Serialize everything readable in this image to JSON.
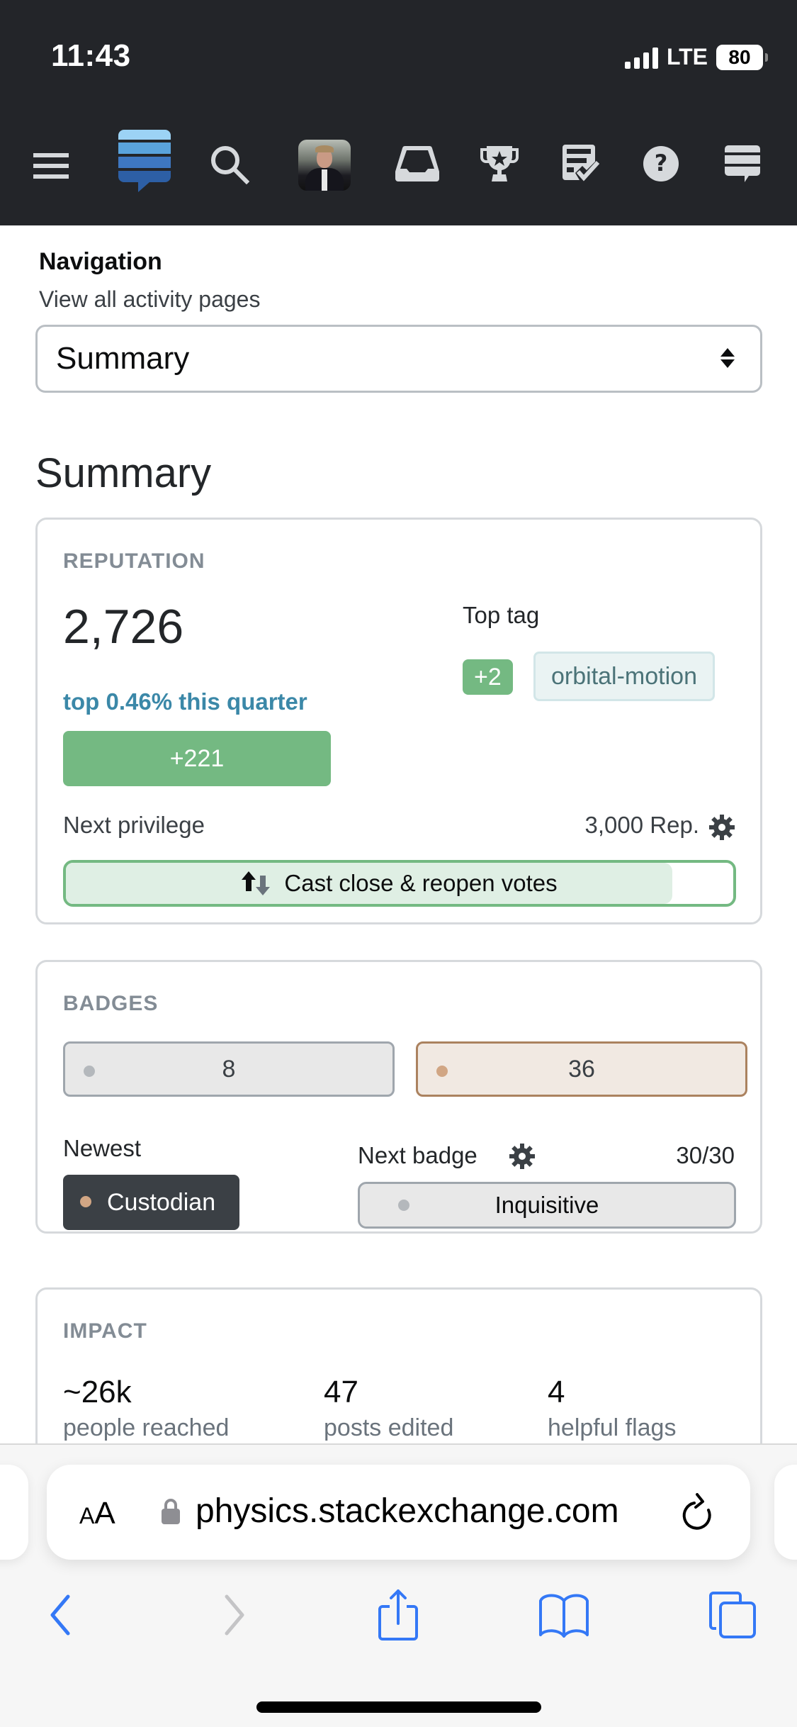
{
  "status_bar": {
    "time": "11:43",
    "network": "LTE",
    "battery": "80"
  },
  "header": {
    "icons": [
      "menu-icon",
      "stackexchange-logo-icon",
      "search-icon",
      "avatar",
      "inbox-icon",
      "achievements-trophy-icon",
      "review-queue-icon",
      "help-icon",
      "site-switcher-icon"
    ],
    "colors": {
      "background": "#232529",
      "icon": "#d6d9dc"
    }
  },
  "navigation": {
    "label": "Navigation",
    "sublabel": "View all activity pages",
    "select_value": "Summary"
  },
  "page_title": "Summary",
  "reputation": {
    "title": "REPUTATION",
    "value": "2,726",
    "rank_text": "top 0.46% this quarter",
    "change": "+221",
    "top_tag_label": "Top tag",
    "top_tag_score": "+2",
    "top_tag": "orbital-motion",
    "next_privilege_label": "Next privilege",
    "next_privilege_rep": "3,000 Rep.",
    "next_privilege_name": "Cast close & reopen votes",
    "next_privilege_progress": 0.909
  },
  "badges": {
    "title": "BADGES",
    "silver_count": "8",
    "bronze_count": "36",
    "newest_label": "Newest",
    "newest_badge": "Custodian",
    "next_badge_label": "Next badge",
    "next_badge_progress": "30/30",
    "next_badge": "Inquisitive"
  },
  "impact": {
    "title": "IMPACT",
    "stats": [
      {
        "value": "~26k",
        "label": "people reached"
      },
      {
        "value": "47",
        "label": "posts edited"
      },
      {
        "value": "4",
        "label": "helpful flags"
      }
    ]
  },
  "browser": {
    "text_size_label_small": "A",
    "text_size_label_large": "A",
    "url": "physics.stackexchange.com",
    "accent_color": "#3478f6"
  },
  "colors": {
    "green": "#74b982",
    "link_blue": "#3b88a8",
    "silver": "#b4b8bc",
    "bronze": "#d1a684"
  }
}
